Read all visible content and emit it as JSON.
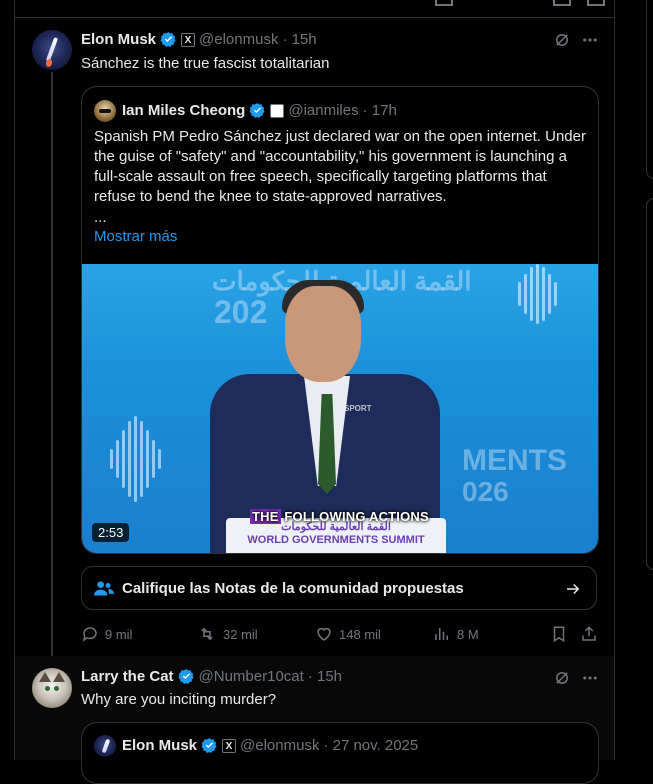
{
  "tweet1": {
    "name": "Elon Musk",
    "handle": "@elonmusk",
    "time": "· 15h",
    "badge": "X",
    "text": "Sánchez is the true fascist totalitarian"
  },
  "quote1": {
    "name": "Ian Miles Cheong",
    "handle": "@ianmiles",
    "time": "· 17h",
    "text": "Spanish PM Pedro Sánchez just declared war on the open internet. Under the guise of \"safety\" and \"accountability,\" his government is launching a full-scale assault on free speech, specifically targeting platforms that refuse to bend the knee to state-approved narratives.",
    "ellipsis": "...",
    "show_more": "Mostrar más",
    "video": {
      "duration": "2:53",
      "caption_highlight": "THE",
      "caption_rest": " FOLLOWING ACTIONS",
      "podium_line1": "القمة العالمية للحكومات",
      "podium_line2": "WORLD GOVERNMENTS SUMMIT",
      "bg_text_right": "MENTS",
      "bg_year_right": "026",
      "bg_year_left": "202",
      "watermark": "SPORT"
    }
  },
  "community_notes": {
    "label": "Califique las Notas de la comunidad propuestas"
  },
  "actions1": {
    "replies": "9 mil",
    "reposts": "32 mil",
    "likes": "148 mil",
    "views": "8 M"
  },
  "tweet2": {
    "name": "Larry the Cat",
    "handle": "@Number10cat",
    "time": "· 15h",
    "text": "Why are you inciting murder?"
  },
  "quote2": {
    "name": "Elon Musk",
    "handle": "@elonmusk",
    "time": "· 27 nov. 2025",
    "badge": "X"
  },
  "colors": {
    "accent": "#1d9bf0",
    "verified": "#1d9bf0",
    "muted": "#71767b",
    "border": "#2f3336"
  }
}
